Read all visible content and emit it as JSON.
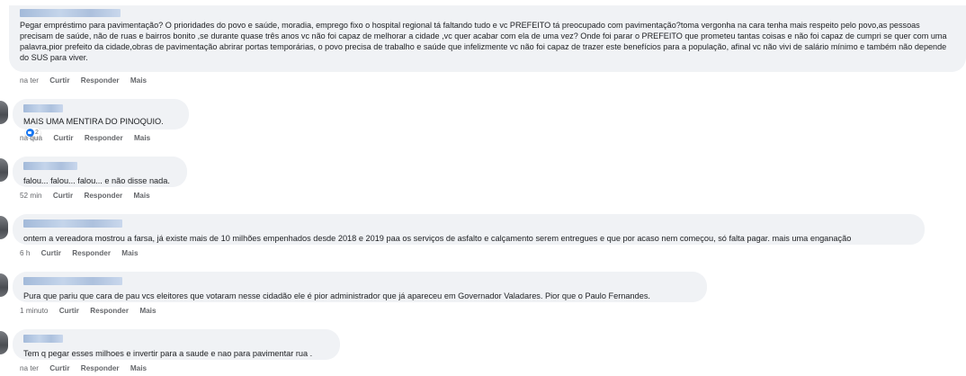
{
  "comments": [
    {
      "author": "",
      "text": "Pegar empréstimo para pavimentação? O prioridades do povo e saúde, moradia, emprego fixo o hospital regional tá faltando tudo e vc PREFEITO tá preocupado com pavimentação?toma vergonha na cara tenha mais respeito pelo povo,as pessoas precisam de saúde, não de ruas e bairros bonito ,se durante quase três anos vc não foi capaz de melhorar a cidade ,vc quer acabar com ela de uma vez? Onde foi parar o PREFEITO que prometeu tantas coisas e não foi capaz de cumpri se quer com uma palavra,pior prefeito da cidade,obras de pavimentação abrirar portas temporárias, o povo precisa de trabalho e saúde que infelizmente vc não foi capaz de trazer este benefícios para a população, afinal vc não vivi de salário mínimo e também não depende do SUS para viver.",
      "time": "na ter",
      "like": "Curtir",
      "reply": "Responder",
      "more": "Mais"
    },
    {
      "author": "",
      "text": "MAIS UMA MENTIRA DO PINOQUIO.",
      "reaction_count": "2",
      "time": "na qua",
      "like": "Curtir",
      "reply": "Responder",
      "more": "Mais"
    },
    {
      "author": "",
      "text": "falou... falou... falou... e não disse nada.",
      "time": "52 min",
      "like": "Curtir",
      "reply": "Responder",
      "more": "Mais"
    },
    {
      "author": "",
      "text": "ontem a vereadora mostrou a farsa, já existe mais de 10 milhões empenhados desde 2018 e 2019 paa os serviços de asfalto e calçamento serem entregues e que por acaso nem começou, só falta pagar. mais uma enganação",
      "time": "6 h",
      "like": "Curtir",
      "reply": "Responder",
      "more": "Mais"
    },
    {
      "author": "",
      "text": "Pura que pariu que cara de pau vcs eleitores que votaram nesse cidadão ele é pior administrador que já apareceu em Governador Valadares. Pior que o Paulo Fernandes.",
      "time": "1 minuto",
      "like": "Curtir",
      "reply": "Responder",
      "more": "Mais"
    },
    {
      "author": "",
      "text": "Tem q pegar esses milhoes e invertir para a saude e nao para pavimentar rua .",
      "time": "na ter",
      "like": "Curtir",
      "reply": "Responder",
      "more": "Mais"
    }
  ],
  "icons": {
    "reaction": "like-icon"
  },
  "colors": {
    "bubble": "#f0f2f5",
    "link": "#65676b",
    "like": "#1877f2"
  }
}
